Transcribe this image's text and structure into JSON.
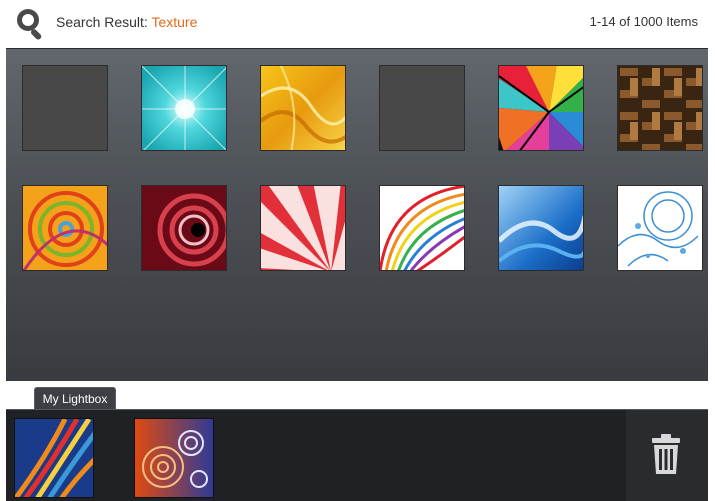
{
  "header": {
    "search_label": "Search Result: ",
    "search_term": "Texture",
    "result_count": "1-14 of 1000 Items"
  },
  "gallery": {
    "thumbnails": [
      {
        "pattern": "empty"
      },
      {
        "pattern": "cyan-burst"
      },
      {
        "pattern": "gold-waves"
      },
      {
        "pattern": "empty"
      },
      {
        "pattern": "color-wheel"
      },
      {
        "pattern": "basket-weave"
      },
      {
        "pattern": "orange-swirl"
      },
      {
        "pattern": "red-spiral"
      },
      {
        "pattern": "red-rays"
      },
      {
        "pattern": "rainbow-arcs"
      },
      {
        "pattern": "blue-wave"
      },
      {
        "pattern": "blue-floral"
      }
    ]
  },
  "lightbox": {
    "tab_label": "My Lightbox",
    "items": [
      {
        "pattern": "flame-streaks"
      },
      {
        "pattern": "orange-spirals"
      }
    ],
    "trash_icon": "trash-icon"
  },
  "colors": {
    "accent": "#e36a1c",
    "gallery_top": "#62676d",
    "gallery_bottom": "#383b3f",
    "lightbox_bg": "#202124"
  }
}
